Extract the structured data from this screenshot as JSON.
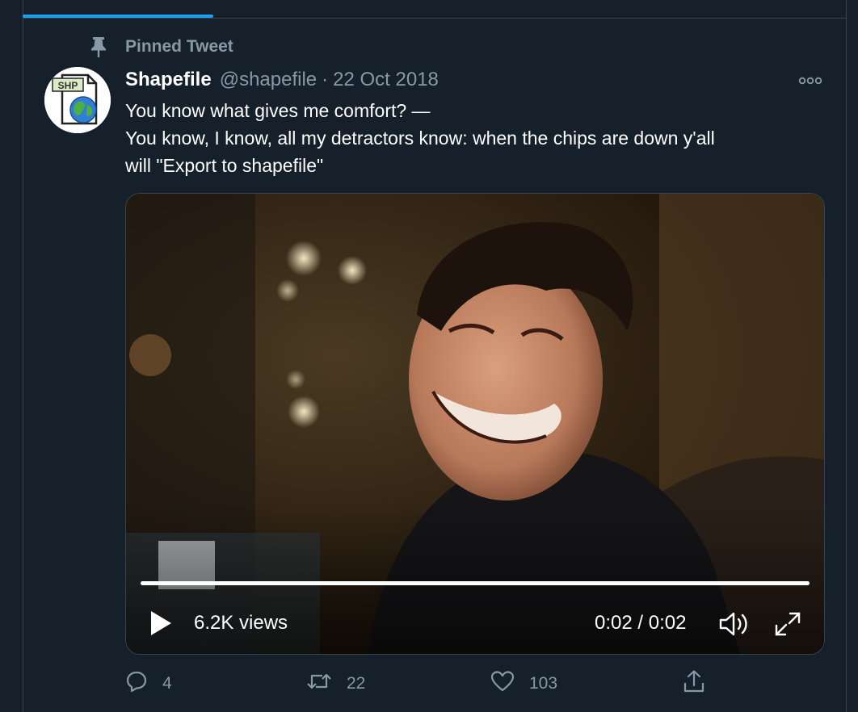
{
  "tweet": {
    "pinned_label": "Pinned Tweet",
    "display_name": "Shapefile",
    "handle": "@shapefile",
    "separator": "·",
    "date": "22 Oct 2018",
    "text_lines": [
      "You know what gives me comfort? —",
      "You know, I know, all my detractors know: when the chips are down y'all",
      "will \"Export to shapefile\""
    ],
    "avatar": {
      "badge_text": "SHP"
    },
    "media": {
      "views": "6.2K views",
      "time": "0:02 / 0:02",
      "progress": 1.0
    },
    "actions": {
      "reply_count": "4",
      "retweet_count": "22",
      "like_count": "103"
    }
  },
  "colors": {
    "background": "#15202b",
    "border": "#38444d",
    "accent": "#1da1f2",
    "secondary_text": "#8899a6",
    "primary_text": "#ffffff"
  },
  "icons": {
    "pin": "pin-icon",
    "more": "more-icon",
    "play": "play-icon",
    "volume": "volume-icon",
    "fullscreen": "fullscreen-icon",
    "reply": "reply-icon",
    "retweet": "retweet-icon",
    "like": "like-icon",
    "share": "share-icon"
  }
}
